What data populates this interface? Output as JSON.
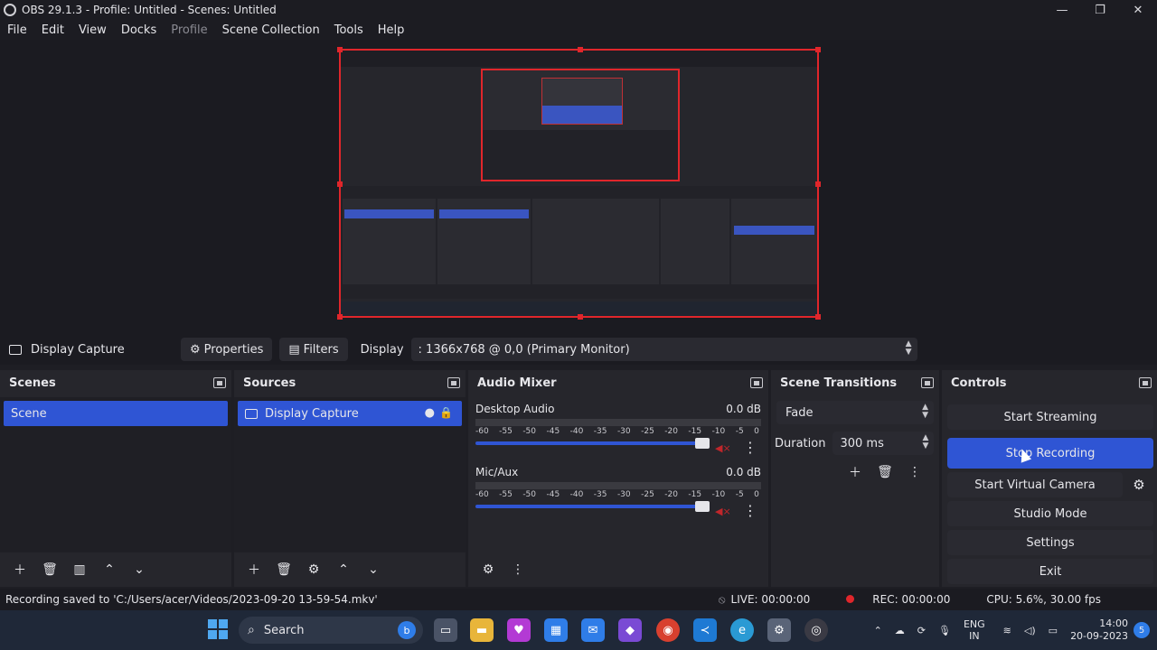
{
  "window": {
    "title": "OBS 29.1.3 - Profile: Untitled - Scenes: Untitled",
    "controls": [
      "—",
      "❐",
      "✕"
    ]
  },
  "menu": [
    "File",
    "Edit",
    "View",
    "Docks",
    "Profile",
    "Scene Collection",
    "Tools",
    "Help"
  ],
  "context_bar": {
    "source_name": "Display Capture",
    "properties_label": "Properties",
    "filters_label": "Filters",
    "display_label": "Display",
    "display_value": ": 1366x768 @ 0,0 (Primary Monitor)"
  },
  "scenes": {
    "title": "Scenes",
    "items": [
      "Scene"
    ]
  },
  "sources": {
    "title": "Sources",
    "items": [
      "Display Capture"
    ]
  },
  "mixer": {
    "title": "Audio Mixer",
    "ticks": [
      "-60",
      "-55",
      "-50",
      "-45",
      "-40",
      "-35",
      "-30",
      "-25",
      "-20",
      "-15",
      "-10",
      "-5",
      "0"
    ],
    "channels": [
      {
        "name": "Desktop Audio",
        "level": "0.0 dB"
      },
      {
        "name": "Mic/Aux",
        "level": "0.0 dB"
      }
    ]
  },
  "transitions": {
    "title": "Scene Transitions",
    "selected": "Fade",
    "duration_label": "Duration",
    "duration_value": "300 ms"
  },
  "controls": {
    "title": "Controls",
    "start_streaming": "Start Streaming",
    "stop_recording": "Stop Recording",
    "start_virtual_camera": "Start Virtual Camera",
    "studio_mode": "Studio Mode",
    "settings": "Settings",
    "exit": "Exit"
  },
  "status": {
    "message": "Recording saved to 'C:/Users/acer/Videos/2023-09-20 13-59-54.mkv'",
    "live": "LIVE: 00:00:00",
    "rec": "REC: 00:00:00",
    "cpu": "CPU: 5.6%, 30.00 fps"
  },
  "taskbar": {
    "search_placeholder": "Search",
    "lang_top": "ENG",
    "lang_bottom": "IN",
    "time": "14:00",
    "date": "20-09-2023"
  },
  "colors": {
    "accent": "#2f55d4",
    "preview_border": "#e0262b",
    "background": "#1e1e24"
  }
}
